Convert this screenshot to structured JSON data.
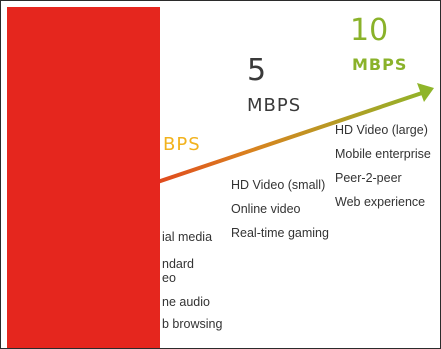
{
  "tiers": [
    {
      "id": "tier-low",
      "speed_number": "",
      "speed_unit": "BPS",
      "uses": [
        "",
        "ial media",
        "ndard",
        "eo",
        "ne audio",
        "b browsing"
      ]
    },
    {
      "id": "tier-mid",
      "speed_number": "5",
      "speed_unit": "MBPS",
      "uses": [
        "HD Video (small)",
        "Online video",
        "Real-time gaming"
      ]
    },
    {
      "id": "tier-high",
      "speed_number": "10",
      "speed_unit": "MBPS",
      "uses": [
        "HD Video (large)",
        "Mobile enterprise",
        "Peer-2-peer",
        "Web experience"
      ]
    }
  ],
  "colors": {
    "arrow_start": "#e5261e",
    "arrow_mid": "#d9821f",
    "arrow_end": "#8fb52a",
    "redaction": "#e5261e",
    "tier_low_label": "#f2b21c",
    "tier_mid_label": "#3a3a3a",
    "tier_high_label": "#8ab22a"
  }
}
